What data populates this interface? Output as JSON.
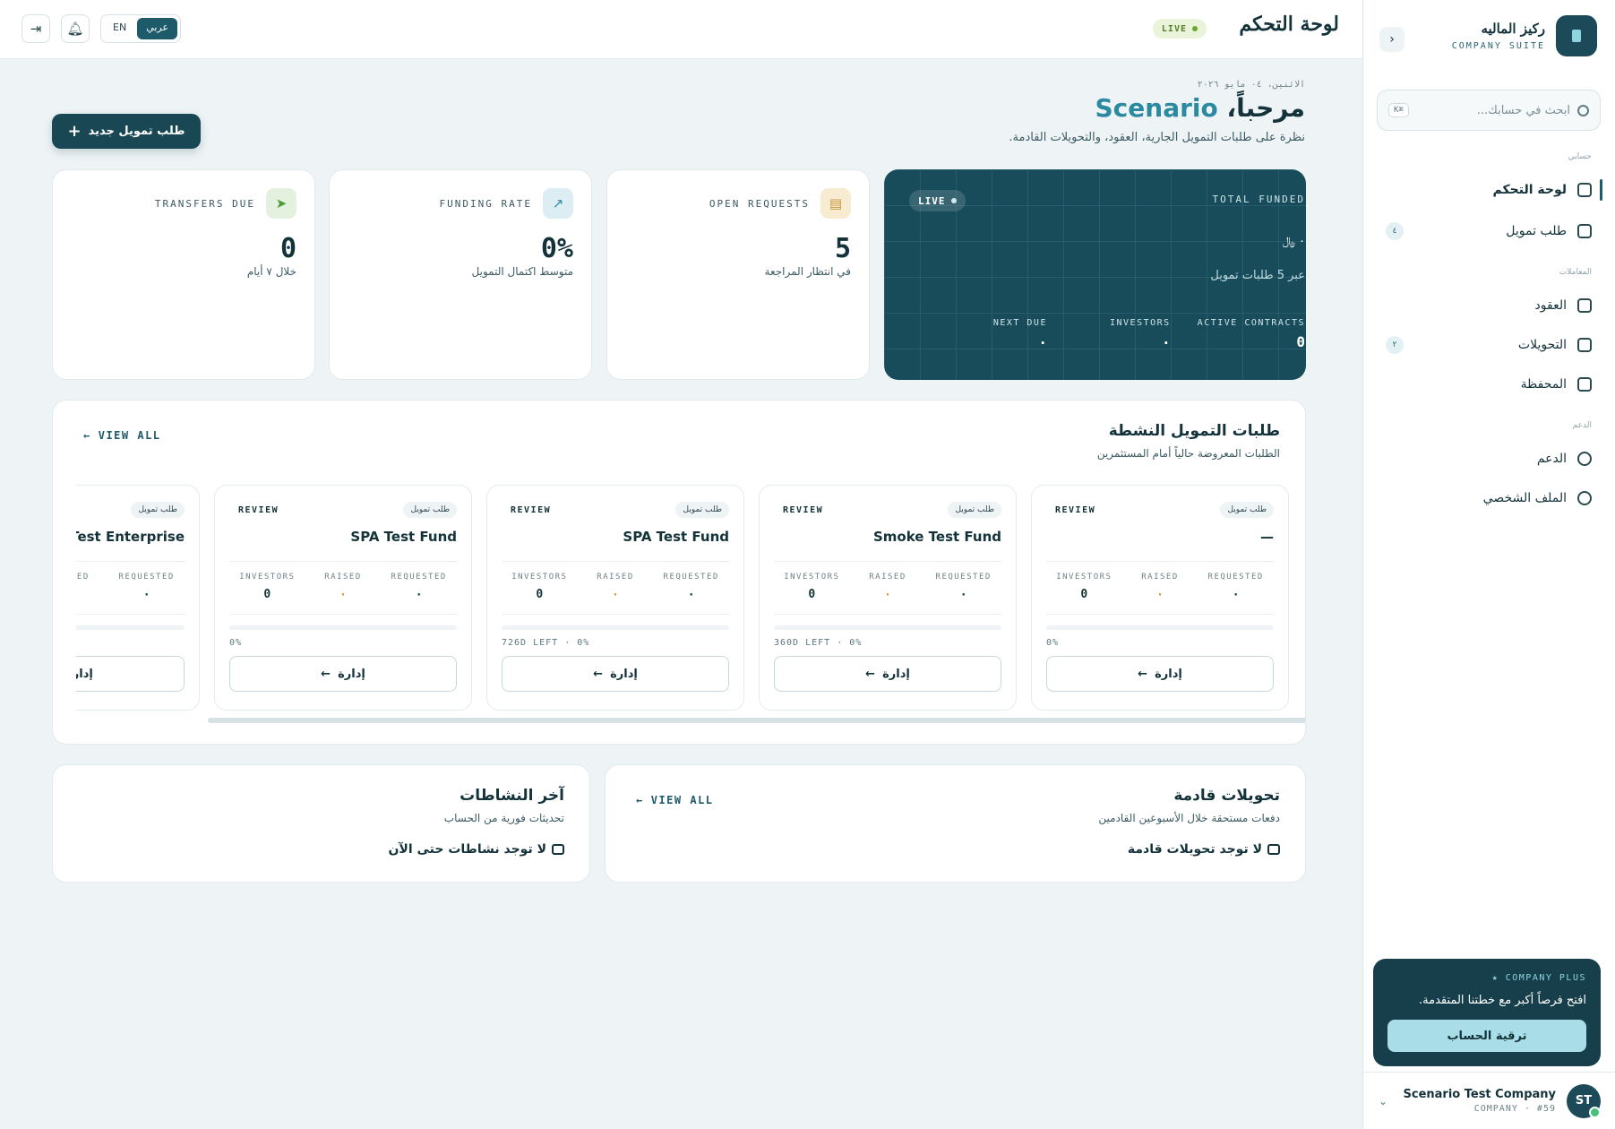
{
  "sidebar": {
    "brand_name": "ركيز الماليه",
    "brand_sub": "COMPANY SUITE",
    "search_placeholder": "ابحث في حسابك...",
    "search_kbd": "K⌘",
    "sections": {
      "account": "حسابي",
      "transactions": "المعاملات",
      "support": "الدعم"
    },
    "items": [
      {
        "label": "لوحة التحكم"
      },
      {
        "label": "طلب تمويل",
        "count": "٤"
      },
      {
        "label": "العقود"
      },
      {
        "label": "التحويلات",
        "count": "٢"
      },
      {
        "label": "المحفظة"
      },
      {
        "label": "الدعم"
      },
      {
        "label": "الملف الشخصي"
      }
    ],
    "plus": {
      "title": "COMPANY PLUS",
      "text": "افتح فرصاً أكبر مع خطتنا المتقدمة.",
      "button": "ترقية الحساب"
    },
    "user": {
      "initials": "ST",
      "name": "Scenario Test Company",
      "meta": "COMPANY · #59"
    }
  },
  "topbar": {
    "title": "لوحة التحكم",
    "live": "LIVE",
    "lang_en": "EN",
    "lang_ar": "عربي"
  },
  "main": {
    "date": "الاثنين، ٠٤ مايو ٢٠٢٦",
    "welcome_prefix": "مرحباً،",
    "welcome_name": "Scenario",
    "subtitle": "نظرة على طلبات التمويل الجارية، العقود، والتحويلات القادمة.",
    "new_request": "طلب تمويل جديد"
  },
  "hero": {
    "live": "LIVE",
    "label": "TOTAL FUNDED",
    "amount": "٠ ﷼",
    "note": "عبر 5 طلبات تمويل",
    "stats": [
      {
        "key": "ACTIVE CONTRACTS",
        "value": "0"
      },
      {
        "key": "INVESTORS",
        "value": "٠"
      },
      {
        "key": "NEXT DUE",
        "value": "٠"
      }
    ]
  },
  "stats": [
    {
      "label": "OPEN REQUESTS",
      "value": "5",
      "note": "في انتظار المراجعة",
      "icon": "document-icon",
      "color": "#f7ecd2"
    },
    {
      "label": "FUNDING RATE",
      "value": "0%",
      "note": "متوسط اكتمال التمويل",
      "icon": "chart-icon",
      "color": "#dcedf4"
    },
    {
      "label": "TRANSFERS DUE",
      "value": "0",
      "note": "خلال ٧ أيام",
      "icon": "send-icon",
      "color": "#e3f1de"
    }
  ],
  "active": {
    "title": "طلبات التمويل النشطة",
    "subtitle": "الطلبات المعروضة حالياً أمام المستثمرين",
    "view_all": "VIEW ALL",
    "labels": {
      "investors": "INVESTORS",
      "raised": "RAISED",
      "requested": "REQUESTED"
    },
    "manage": "إدارة",
    "cards": [
      {
        "badge": "طلب تمويل",
        "status": "REVIEW",
        "title": "—",
        "investors": "0",
        "raised": "٠",
        "requested": "٠",
        "progress": 0,
        "left": "0%"
      },
      {
        "badge": "طلب تمويل",
        "status": "REVIEW",
        "title": "Smoke Test Fund",
        "investors": "0",
        "raised": "٠",
        "requested": "٠",
        "progress": 0,
        "left": "360D LEFT · 0%"
      },
      {
        "badge": "طلب تمويل",
        "status": "REVIEW",
        "title": "SPA Test Fund",
        "investors": "0",
        "raised": "٠",
        "requested": "٠",
        "progress": 0,
        "left": "726D LEFT · 0%"
      },
      {
        "badge": "طلب تمويل",
        "status": "REVIEW",
        "title": "SPA Test Fund",
        "investors": "0",
        "raised": "٠",
        "requested": "٠",
        "progress": 0,
        "left": "0%"
      },
      {
        "badge": "طلب تمويل",
        "status": "",
        "title": "Test Enterprise",
        "investors": "",
        "raised": "",
        "requested": "٠",
        "progress": 0,
        "left": ""
      }
    ]
  },
  "transfers": {
    "title": "تحويلات قادمة",
    "subtitle": "دفعات مستحقة خلال الأسبوعين القادمين",
    "view_all": "VIEW ALL",
    "empty": "لا توجد تحويلات قادمة"
  },
  "activity": {
    "title": "آخر النشاطات",
    "subtitle": "تحديثات فورية من الحساب",
    "empty": "لا توجد نشاطات حتى الآن"
  }
}
